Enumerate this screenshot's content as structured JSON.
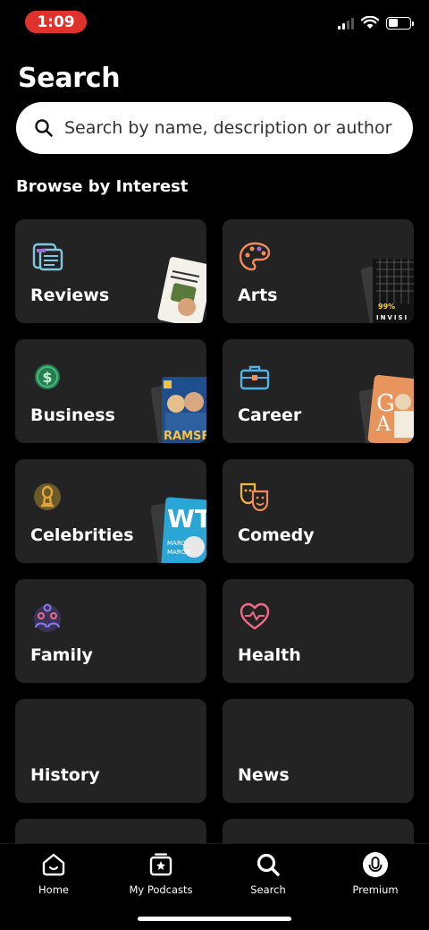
{
  "status_bar": {
    "time": "1:09",
    "battery_level": 0.45
  },
  "page_title": "Search",
  "search": {
    "placeholder": "Search by name, description or author"
  },
  "browse_title": "Browse by Interest",
  "categories": [
    {
      "label": "Reviews",
      "icon": "reviews-icon",
      "color": "#7ec8e3"
    },
    {
      "label": "Arts",
      "icon": "palette-icon",
      "color": "#f28b5b"
    },
    {
      "label": "Business",
      "icon": "dollar-coin-icon",
      "color": "#3fbf7f"
    },
    {
      "label": "Career",
      "icon": "briefcase-icon",
      "color": "#4fb3e8"
    },
    {
      "label": "Celebrities",
      "icon": "award-icon",
      "color": "#e3a43a"
    },
    {
      "label": "Comedy",
      "icon": "comedy-masks-icon",
      "color": "#f5b740"
    },
    {
      "label": "Family",
      "icon": "family-icon",
      "color": "#8a7cf0"
    },
    {
      "label": "Health",
      "icon": "heart-pulse-icon",
      "color": "#f06b8a"
    },
    {
      "label": "History",
      "icon": "",
      "color": ""
    },
    {
      "label": "News",
      "icon": "",
      "color": ""
    }
  ],
  "nav": [
    {
      "label": "Home",
      "icon": "home-icon"
    },
    {
      "label": "My Podcasts",
      "icon": "podcasts-icon"
    },
    {
      "label": "Search",
      "icon": "search-icon"
    },
    {
      "label": "Premium",
      "icon": "premium-icon"
    }
  ]
}
